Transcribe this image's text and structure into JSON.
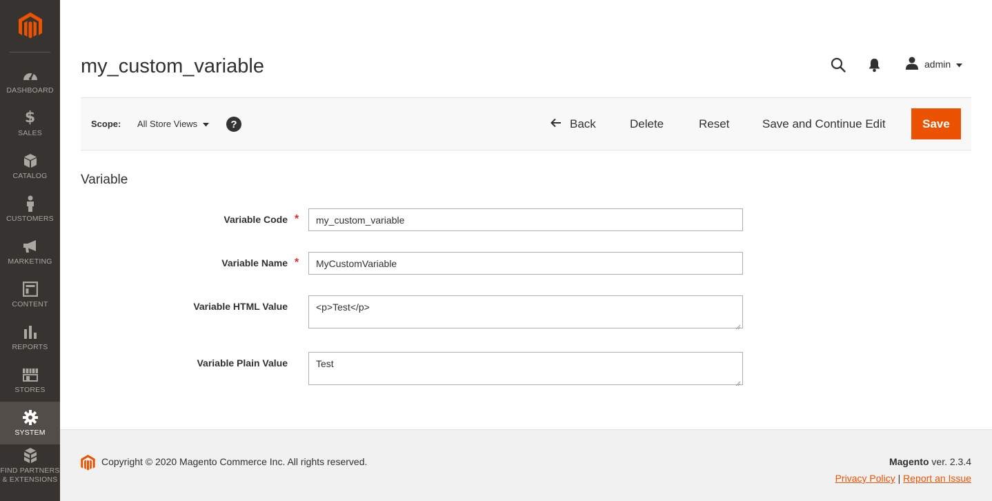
{
  "colors": {
    "sidebar_bg": "#373330",
    "sidebar_active": "#524d49",
    "accent": "#eb5202",
    "required": "#e22626"
  },
  "sidebar": {
    "items": [
      {
        "label": "DASHBOARD",
        "icon": "dashboard-icon"
      },
      {
        "label": "SALES",
        "icon": "dollar-icon"
      },
      {
        "label": "CATALOG",
        "icon": "box-icon"
      },
      {
        "label": "CUSTOMERS",
        "icon": "person-icon"
      },
      {
        "label": "MARKETING",
        "icon": "megaphone-icon"
      },
      {
        "label": "CONTENT",
        "icon": "layout-icon"
      },
      {
        "label": "REPORTS",
        "icon": "bar-chart-icon"
      },
      {
        "label": "STORES",
        "icon": "storefront-icon"
      },
      {
        "label": "SYSTEM",
        "icon": "gear-icon",
        "active": true
      },
      {
        "label_line1": "FIND PARTNERS",
        "label_line2": "& EXTENSIONS",
        "icon": "cubes-icon"
      }
    ]
  },
  "header": {
    "title": "my_custom_variable",
    "user": "admin"
  },
  "action_bar": {
    "scope_label": "Scope:",
    "scope_value": "All Store Views",
    "help": "?",
    "back": "Back",
    "delete": "Delete",
    "reset": "Reset",
    "save_continue": "Save and Continue Edit",
    "save": "Save"
  },
  "form": {
    "section_title": "Variable",
    "fields": [
      {
        "label": "Variable Code",
        "required": "*",
        "value": "my_custom_variable"
      },
      {
        "label": "Variable Name",
        "required": "*",
        "value": "MyCustomVariable"
      },
      {
        "label": "Variable HTML Value",
        "value": "<p>Test</p>"
      },
      {
        "label": "Variable Plain Value",
        "value": "Test"
      }
    ]
  },
  "footer": {
    "copyright": "Copyright © 2020 Magento Commerce Inc. All rights reserved.",
    "brand": "Magento",
    "version": " ver. 2.3.4",
    "privacy": "Privacy Policy",
    "separator": "|",
    "report": "Report an Issue"
  }
}
